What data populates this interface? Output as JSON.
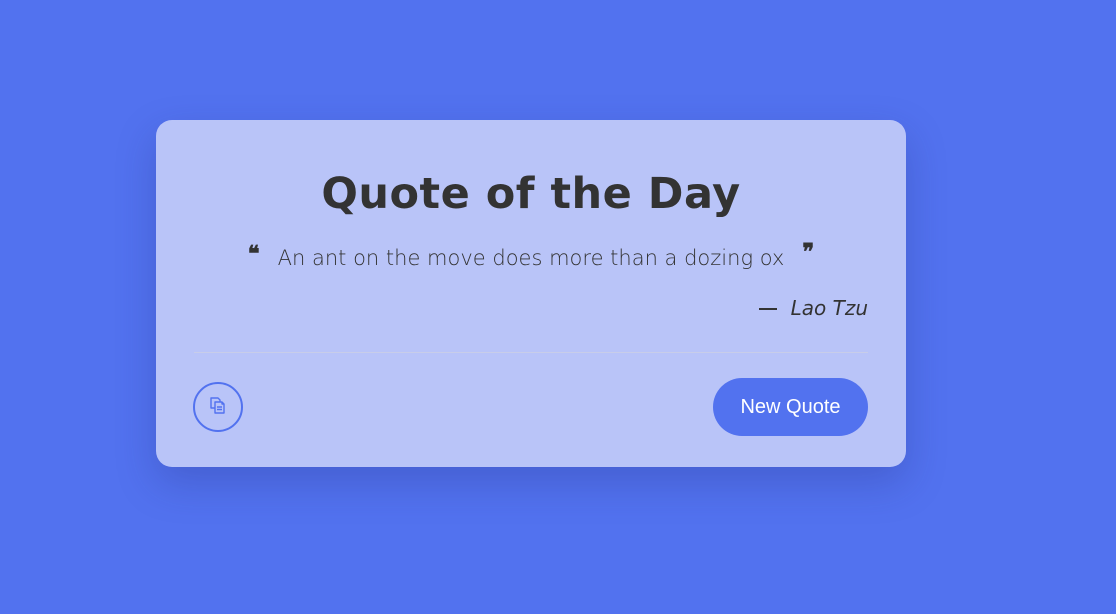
{
  "card": {
    "title": "Quote of the Day",
    "quote": "An ant on the move does more than a dozing ox",
    "open_quote_mark": "❝",
    "close_quote_mark": "❞",
    "author": "Lao Tzu"
  },
  "actions": {
    "copy_icon": "copy-icon",
    "new_quote_label": "New Quote"
  },
  "colors": {
    "background": "#5272ef",
    "card": "#b9c4f8",
    "accent": "#5272ef",
    "text": "#333333"
  }
}
